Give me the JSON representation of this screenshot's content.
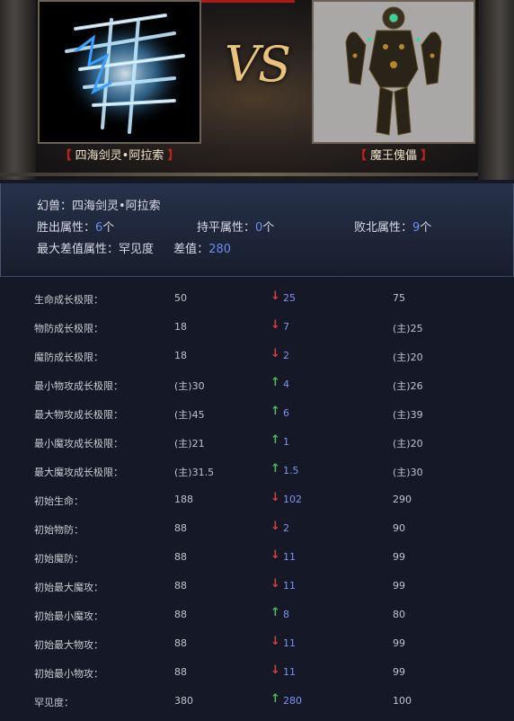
{
  "header": {
    "vs_text": "VS",
    "left_name": "四海剑灵•阿拉索",
    "right_name": "魔王傀儡",
    "bracket_open": "【",
    "bracket_close": "】"
  },
  "summary": {
    "pet_label": "幻兽：",
    "pet_name": "四海剑灵•阿拉索",
    "win_label": "胜出属性：",
    "win_count": "6",
    "draw_label": "持平属性：",
    "draw_count": "0",
    "lose_label": "败北属性：",
    "lose_count": "9",
    "unit": "个",
    "max_diff_label": "最大差值属性：",
    "max_diff_attr": "罕见度",
    "diff_label": "差值：",
    "diff_value": "280"
  },
  "rows": [
    {
      "label": "生命成长极限：",
      "left": "50",
      "dir": "down",
      "diff": "25",
      "right": "75"
    },
    {
      "label": "物防成长极限：",
      "left": "18",
      "dir": "down",
      "diff": "7",
      "right": "(主)25"
    },
    {
      "label": "魔防成长极限：",
      "left": "18",
      "dir": "down",
      "diff": "2",
      "right": "(主)20"
    },
    {
      "label": "最小物攻成长极限：",
      "left": "(主)30",
      "dir": "up",
      "diff": "4",
      "right": "(主)26"
    },
    {
      "label": "最大物攻成长极限：",
      "left": "(主)45",
      "dir": "up",
      "diff": "6",
      "right": "(主)39"
    },
    {
      "label": "最小魔攻成长极限：",
      "left": "(主)21",
      "dir": "up",
      "diff": "1",
      "right": "(主)20"
    },
    {
      "label": "最大魔攻成长极限：",
      "left": "(主)31.5",
      "dir": "up",
      "diff": "1.5",
      "right": "(主)30"
    },
    {
      "label": "初始生命：",
      "left": "188",
      "dir": "down",
      "diff": "102",
      "right": "290"
    },
    {
      "label": "初始物防：",
      "left": "88",
      "dir": "down",
      "diff": "2",
      "right": "90"
    },
    {
      "label": "初始魔防：",
      "left": "88",
      "dir": "down",
      "diff": "11",
      "right": "99"
    },
    {
      "label": "初始最大魔攻：",
      "left": "88",
      "dir": "down",
      "diff": "11",
      "right": "99"
    },
    {
      "label": "初始最小魔攻：",
      "left": "88",
      "dir": "up",
      "diff": "8",
      "right": "80"
    },
    {
      "label": "初始最大物攻：",
      "left": "88",
      "dir": "down",
      "diff": "11",
      "right": "99"
    },
    {
      "label": "初始最小物攻：",
      "left": "88",
      "dir": "down",
      "diff": "11",
      "right": "99"
    },
    {
      "label": "罕见度：",
      "left": "380",
      "dir": "up",
      "diff": "280",
      "right": "100"
    }
  ],
  "arrows": {
    "up": "↑",
    "down": "↓"
  },
  "colors": {
    "up": "#3fc35a",
    "down": "#e23b3b",
    "value_blue": "#7d93f4"
  }
}
